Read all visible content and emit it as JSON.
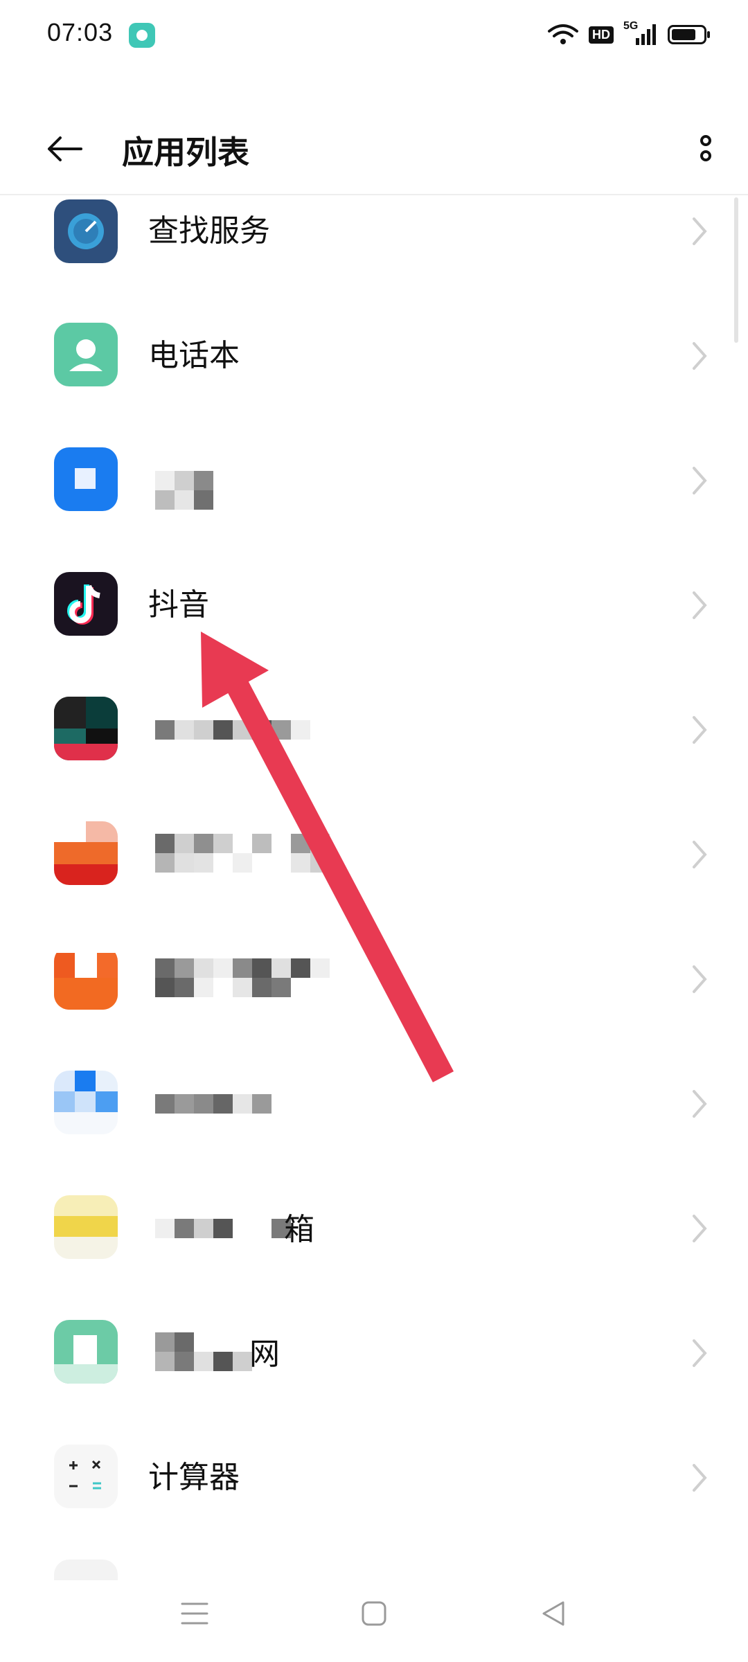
{
  "status_bar": {
    "time": "07:03",
    "hd_label": "HD",
    "network_label": "5G"
  },
  "header": {
    "title": "应用列表",
    "back_icon": "back-arrow-icon",
    "more_icon": "more-vertical-icon"
  },
  "apps": [
    {
      "name": "查找服务",
      "icon": "find-service-icon",
      "color": "#2e4f7c"
    },
    {
      "name": "电话本",
      "icon": "contacts-icon",
      "color": "#5cc9a4"
    },
    {
      "name": "",
      "icon": "blurred-app-icon",
      "color": "#1a7cf0"
    },
    {
      "name": "抖音",
      "icon": "douyin-icon",
      "color": "#1a1320"
    },
    {
      "name": "",
      "icon": "blurred-app-icon",
      "color": "#111111"
    },
    {
      "name": "",
      "icon": "blurred-app-icon",
      "color": "#e84a20"
    },
    {
      "name": "",
      "icon": "blurred-app-icon",
      "color": "#f36a2a"
    },
    {
      "name": "",
      "icon": "blurred-app-icon",
      "color": "#5aa0f0"
    },
    {
      "name": "箱",
      "icon": "blurred-app-icon",
      "color": "#f0d54a"
    },
    {
      "name": "网",
      "icon": "blurred-app-icon",
      "color": "#6ccba6"
    },
    {
      "name": "计算器",
      "icon": "calculator-icon",
      "color": "#f6f6f6"
    }
  ],
  "colors": {
    "annotation_arrow": "#e83a52"
  }
}
